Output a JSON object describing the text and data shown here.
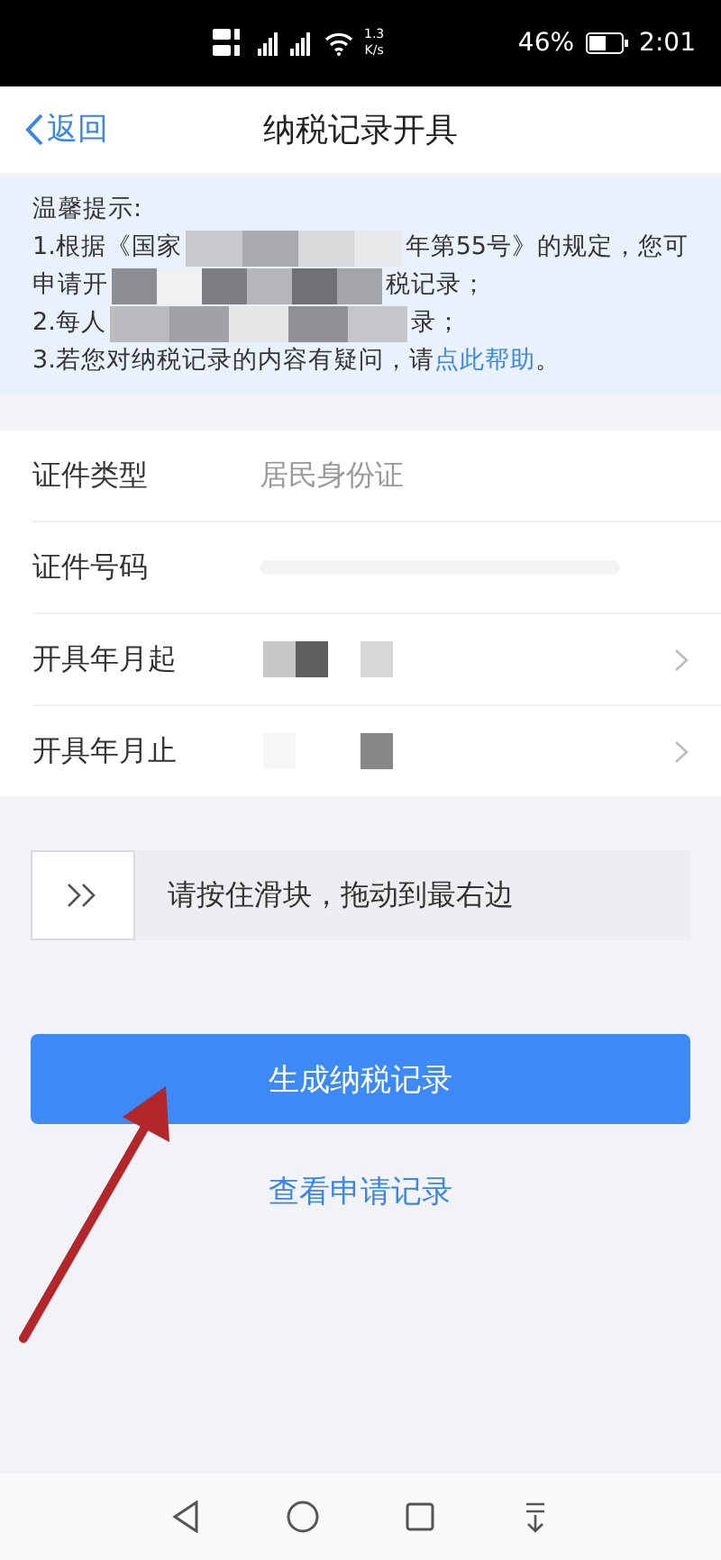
{
  "status_bar": {
    "speed_value": "1.3",
    "speed_unit": "K/s",
    "battery": "46%",
    "time": "2:01"
  },
  "header": {
    "back": "返回",
    "title": "纳税记录开具"
  },
  "tips": {
    "heading": "温馨提示:",
    "lines": [
      {
        "before": "1.根据《国家",
        "redacted": true,
        "after": "年第55号》的规定，您可"
      },
      {
        "before": "申请开",
        "redacted": true,
        "after": "税记录；"
      },
      {
        "before": "2.每人",
        "redacted": true,
        "after": "录；"
      },
      {
        "before": "3.若您对纳税记录的内容有疑问，请",
        "link": "点此帮助",
        "after": "。",
        "redacted": false
      }
    ]
  },
  "form": [
    {
      "label": "证件类型",
      "value": "居民身份证",
      "kind": "text",
      "chevron": false
    },
    {
      "label": "证件号码",
      "kind": "blurred",
      "chevron": false
    },
    {
      "label": "开具年月起",
      "kind": "redacted",
      "chevron": true
    },
    {
      "label": "开具年月止",
      "kind": "redacted",
      "chevron": true
    }
  ],
  "slider": {
    "hint": "请按住滑块，拖动到最右边",
    "level": 0
  },
  "primary_button": "生成纳税记录",
  "secondary_link": "查看申请记录"
}
